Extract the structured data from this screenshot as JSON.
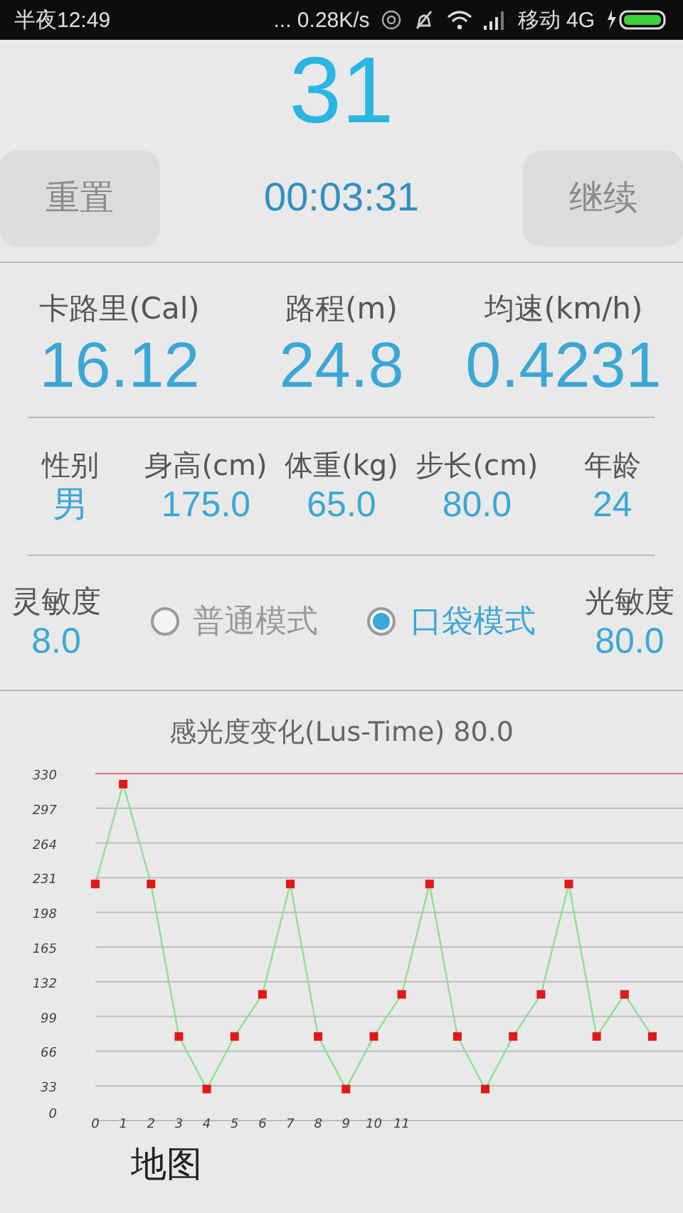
{
  "status_bar": {
    "time": "半夜12:49",
    "speed": "... 0.28K/s",
    "carrier": "移动 4G"
  },
  "counter": "31",
  "controls": {
    "reset": "重置",
    "timer": "00:03:31",
    "resume": "继续"
  },
  "stats": [
    {
      "label": "卡路里(Cal)",
      "value": "16.12"
    },
    {
      "label": "路程(m)",
      "value": "24.8"
    },
    {
      "label": "均速(km/h)",
      "value": "0.4231"
    }
  ],
  "profile": [
    {
      "label": "性别",
      "value": "男"
    },
    {
      "label": "身高(cm)",
      "value": "175.0"
    },
    {
      "label": "体重(kg)",
      "value": "65.0"
    },
    {
      "label": "步长(cm)",
      "value": "80.0"
    },
    {
      "label": "年龄",
      "value": "24"
    }
  ],
  "sensitivity": {
    "label": "灵敏度",
    "value": "8.0"
  },
  "modes": [
    {
      "label": "普通模式",
      "selected": false
    },
    {
      "label": "口袋模式",
      "selected": true
    }
  ],
  "light_sensitivity": {
    "label": "光敏度",
    "value": "80.0"
  },
  "chart": {
    "title": "感光度变化(Lus-Time)  80.0",
    "chart_data": {
      "type": "line",
      "x": [
        0,
        1,
        2,
        3,
        4,
        5,
        6,
        7,
        8,
        9,
        10,
        11,
        12,
        13,
        14,
        15,
        16,
        17,
        18,
        19,
        20
      ],
      "series": [
        {
          "color": "#8fe08f",
          "marker": "square",
          "values": [
            225,
            320,
            225,
            80,
            30,
            80,
            120,
            225,
            80,
            30,
            80,
            120,
            225,
            80,
            30,
            80,
            120,
            225,
            80,
            120,
            80
          ]
        }
      ],
      "xlim": [
        0,
        21.1
      ],
      "ylim": [
        0,
        330
      ],
      "grid": true,
      "yticks": [
        0,
        33,
        66,
        99,
        132,
        165,
        198,
        231,
        264,
        297,
        330
      ],
      "xticks": [
        0,
        1,
        2,
        3,
        4,
        5,
        6,
        7,
        8,
        9,
        10,
        11
      ]
    }
  },
  "map_label": "地图"
}
